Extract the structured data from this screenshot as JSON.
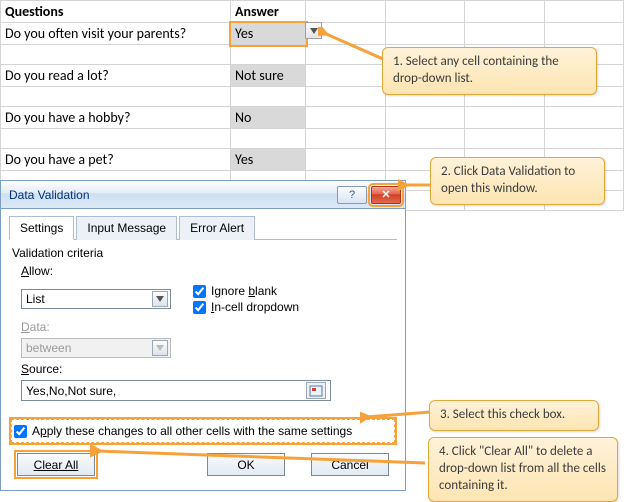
{
  "headers": {
    "questions": "Questions",
    "answer": "Answer"
  },
  "rows": [
    {
      "q": "Do you often visit your parents?",
      "a": "Yes",
      "selected": true
    },
    {
      "q": "",
      "a": ""
    },
    {
      "q": "Do you read a lot?",
      "a": "Not sure"
    },
    {
      "q": "",
      "a": ""
    },
    {
      "q": "Do you have a hobby?",
      "a": "No"
    },
    {
      "q": "",
      "a": ""
    },
    {
      "q": "Do you have a pet?",
      "a": "Yes"
    }
  ],
  "callouts": {
    "c1": "1. Select any cell containing the drop-down list.",
    "c2": "2. Click Data Validation to open this window.",
    "c3": "3. Select this check box.",
    "c4": "4. Click \"Clear All\" to delete a drop-down list from all the cells containing it."
  },
  "dialog": {
    "title": "Data Validation",
    "tabs": {
      "settings": "Settings",
      "input": "Input Message",
      "error": "Error Alert"
    },
    "validation_criteria": "Validation criteria",
    "allow_label": "Allow:",
    "allow_value": "List",
    "data_label": "Data:",
    "data_value": "between",
    "ignore_blank": "Ignore blank",
    "incell": "In-cell dropdown",
    "source_label": "Source:",
    "source_value": "Yes,No,Not sure,",
    "apply": "Apply these changes to all other cells with the same settings",
    "clear_all": "Clear All",
    "ok": "OK",
    "cancel": "Cancel"
  }
}
